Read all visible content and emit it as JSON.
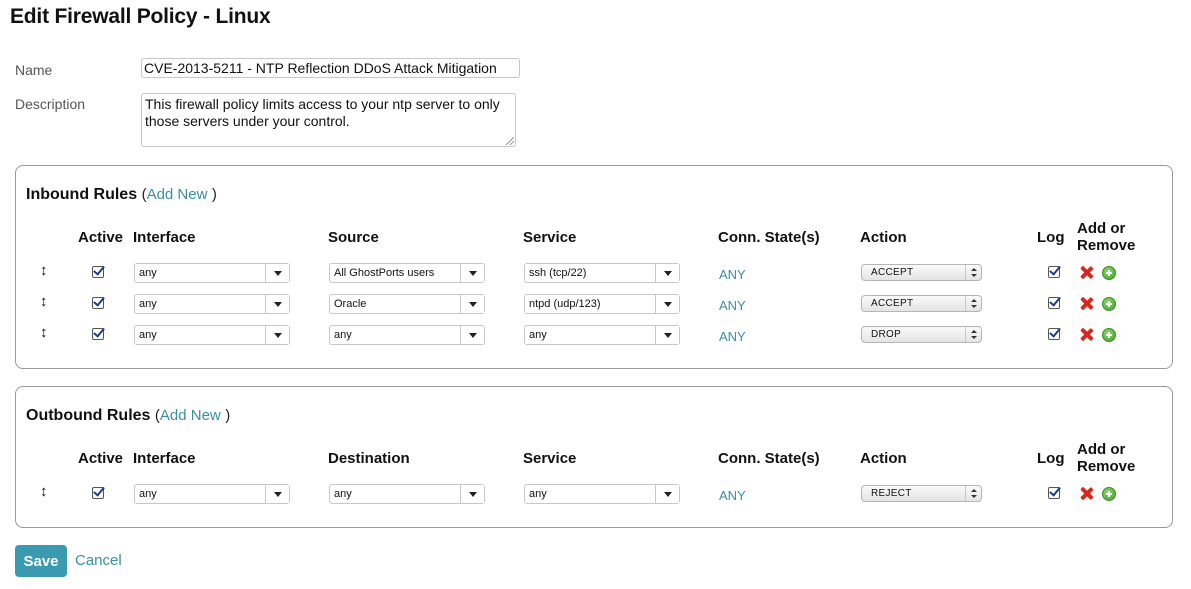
{
  "page": {
    "title": "Edit Firewall Policy - Linux"
  },
  "form": {
    "name_label": "Name",
    "name_value": "CVE-2013-5211 - NTP Reflection DDoS Attack Mitigation",
    "description_label": "Description",
    "description_value": "This firewall policy limits access to your ntp server to only those servers under your control."
  },
  "inbound": {
    "title": "Inbound Rules",
    "paren_open": "(",
    "add_new": "Add New",
    "paren_close": ")",
    "headers": {
      "active": "Active",
      "interface": "Interface",
      "source": "Source",
      "service": "Service",
      "conn_state": "Conn. State(s)",
      "action": "Action",
      "log": "Log",
      "add_remove": "Add or Remove"
    },
    "rows": [
      {
        "drag": "↕",
        "active": true,
        "interface": "any",
        "source": "All GhostPorts users",
        "service": "ssh (tcp/22)",
        "conn_state": "ANY",
        "action": "ACCEPT",
        "log": true
      },
      {
        "drag": "↕",
        "active": true,
        "interface": "any",
        "source": "Oracle",
        "service": "ntpd (udp/123)",
        "conn_state": "ANY",
        "action": "ACCEPT",
        "log": true
      },
      {
        "drag": "↕",
        "active": true,
        "interface": "any",
        "source": "any",
        "service": "any",
        "conn_state": "ANY",
        "action": "DROP",
        "log": true
      }
    ]
  },
  "outbound": {
    "title": "Outbound Rules",
    "paren_open": "(",
    "add_new": "Add New",
    "paren_close": ")",
    "headers": {
      "active": "Active",
      "interface": "Interface",
      "destination": "Destination",
      "service": "Service",
      "conn_state": "Conn. State(s)",
      "action": "Action",
      "log": "Log",
      "add_remove": "Add or Remove"
    },
    "rows": [
      {
        "drag": "↕",
        "active": true,
        "interface": "any",
        "destination": "any",
        "service": "any",
        "conn_state": "ANY",
        "action": "REJECT",
        "log": true
      }
    ]
  },
  "actions": {
    "save": "Save",
    "cancel": "Cancel"
  },
  "colors": {
    "accent": "#3a9ab0",
    "link": "#3a8ea5",
    "remove": "#d9261c",
    "add": "#3fa12a"
  }
}
